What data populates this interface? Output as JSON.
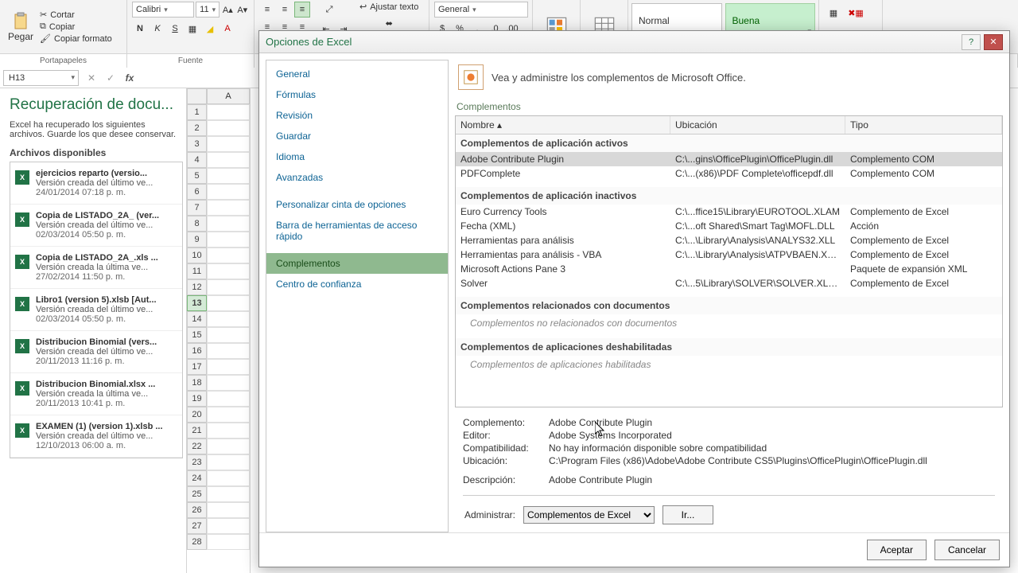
{
  "ribbon": {
    "clipboard": {
      "paste": "Pegar",
      "cut": "Cortar",
      "copy": "Copiar",
      "format_painter": "Copiar formato",
      "group": "Portapapeles"
    },
    "font": {
      "name": "Calibri",
      "size": "11",
      "group": "Fuente",
      "bold": "N",
      "italic": "K",
      "underline": "S"
    },
    "align": {
      "wrap": "Ajustar texto"
    },
    "number": {
      "format": "General"
    },
    "styles": {
      "normal": "Normal",
      "good": "Buena"
    }
  },
  "group_labels": {
    "clipboard": "Portapapeles",
    "font": "Fuente"
  },
  "formula_bar": {
    "namebox": "H13"
  },
  "recovery": {
    "title": "Recuperación de docu...",
    "desc": "Excel ha recuperado los siguientes archivos. Guarde los que desee conservar.",
    "avail": "Archivos disponibles",
    "files": [
      {
        "name": "ejercicios reparto (versio...",
        "note": "Versión creada del último ve...",
        "date": "24/01/2014 07:18 p. m."
      },
      {
        "name": "Copia de LISTADO_2A_ (ver...",
        "note": "Versión creada del último ve...",
        "date": "02/03/2014 05:50 p. m."
      },
      {
        "name": "Copia de LISTADO_2A_.xls ...",
        "note": "Versión creada la última ve...",
        "date": "27/02/2014 11:50 p. m."
      },
      {
        "name": "Libro1 (version 5).xlsb  [Aut...",
        "note": "Versión creada del último ve...",
        "date": "02/03/2014 05:50 p. m."
      },
      {
        "name": "Distribucion Binomial (vers...",
        "note": "Versión creada del último ve...",
        "date": "20/11/2013 11:16 p. m."
      },
      {
        "name": "Distribucion Binomial.xlsx ...",
        "note": "Versión creada la última ve...",
        "date": "20/11/2013 10:41 p. m."
      },
      {
        "name": "EXAMEN (1) (version 1).xlsb ...",
        "note": "Versión creada del último ve...",
        "date": "12/10/2013 06:00 a. m."
      }
    ]
  },
  "sheet": {
    "colA": "A",
    "selected_row": 13,
    "rows": 28
  },
  "dialog": {
    "title": "Opciones de Excel",
    "nav": [
      "General",
      "Fórmulas",
      "Revisión",
      "Guardar",
      "Idioma",
      "Avanzadas"
    ],
    "nav2": [
      "Personalizar cinta de opciones",
      "Barra de herramientas de acceso rápido"
    ],
    "nav3": [
      "Complementos",
      "Centro de confianza"
    ],
    "head_text": "Vea y administre los complementos de Microsoft Office.",
    "section": "Complementos",
    "cols": {
      "name": "Nombre",
      "loc": "Ubicación",
      "type": "Tipo"
    },
    "groups": {
      "active": "Complementos de aplicación activos",
      "inactive": "Complementos de aplicación inactivos",
      "docs": "Complementos relacionados con documentos",
      "docs_empty": "Complementos no relacionados con documentos",
      "disabled": "Complementos de aplicaciones deshabilitadas",
      "disabled_empty": "Complementos de aplicaciones habilitadas"
    },
    "active_addins": [
      {
        "name": "Adobe Contribute Plugin",
        "loc": "C:\\...gins\\OfficePlugin\\OfficePlugin.dll",
        "type": "Complemento COM"
      },
      {
        "name": "PDFComplete",
        "loc": "C:\\...(x86)\\PDF Complete\\officepdf.dll",
        "type": "Complemento COM"
      }
    ],
    "inactive_addins": [
      {
        "name": "Euro Currency Tools",
        "loc": "C:\\...ffice15\\Library\\EUROTOOL.XLAM",
        "type": "Complemento de Excel"
      },
      {
        "name": "Fecha (XML)",
        "loc": "C:\\...oft Shared\\Smart Tag\\MOFL.DLL",
        "type": "Acción"
      },
      {
        "name": "Herramientas para análisis",
        "loc": "C:\\...\\Library\\Analysis\\ANALYS32.XLL",
        "type": "Complemento de Excel"
      },
      {
        "name": "Herramientas para análisis - VBA",
        "loc": "C:\\...\\Library\\Analysis\\ATPVBAEN.XLAM",
        "type": "Complemento de Excel"
      },
      {
        "name": "Microsoft Actions Pane 3",
        "loc": "",
        "type": "Paquete de expansión XML"
      },
      {
        "name": "Solver",
        "loc": "C:\\...5\\Library\\SOLVER\\SOLVER.XLAM",
        "type": "Complemento de Excel"
      }
    ],
    "details": {
      "addin_lbl": "Complemento:",
      "addin_val": "Adobe Contribute Plugin",
      "editor_lbl": "Editor:",
      "editor_val": "Adobe Systems Incorporated",
      "compat_lbl": "Compatibilidad:",
      "compat_val": "No hay información disponible sobre compatibilidad",
      "loc_lbl": "Ubicación:",
      "loc_val": "C:\\Program Files (x86)\\Adobe\\Adobe Contribute CS5\\Plugins\\OfficePlugin\\OfficePlugin.dll",
      "desc_lbl": "Descripción:",
      "desc_val": "Adobe Contribute Plugin"
    },
    "manage": {
      "label": "Administrar:",
      "select": "Complementos de Excel",
      "go": "Ir..."
    },
    "buttons": {
      "ok": "Aceptar",
      "cancel": "Cancelar"
    }
  }
}
